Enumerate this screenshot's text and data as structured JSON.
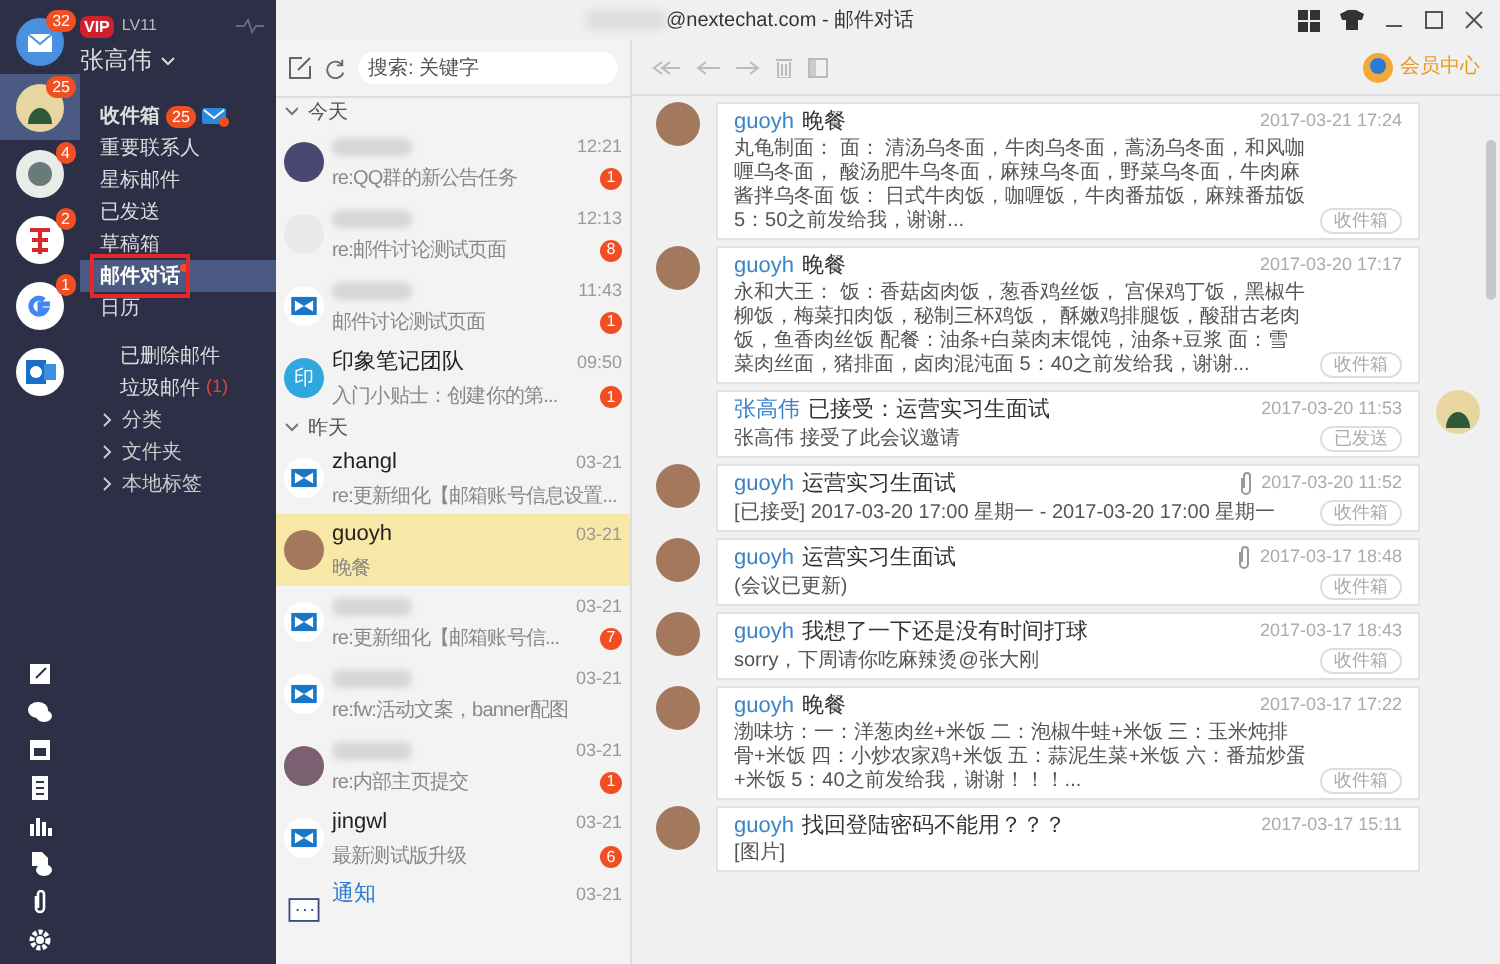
{
  "window": {
    "title": "@nextechat.com - 邮件对话"
  },
  "accounts": [
    {
      "kind": "mail",
      "badge": "32",
      "selected": false
    },
    {
      "kind": "avatar",
      "badge": "25",
      "selected": true
    },
    {
      "kind": "photo",
      "badge": "4",
      "selected": false
    },
    {
      "kind": "netease",
      "badge": "2",
      "selected": false
    },
    {
      "kind": "google",
      "badge": "1",
      "selected": false
    },
    {
      "kind": "outlook",
      "selected": false
    }
  ],
  "user": {
    "vip": "VIP",
    "level": "LV11",
    "name": "张高伟"
  },
  "folders": [
    {
      "kind": "item",
      "label": "收件箱",
      "badge": "25",
      "selected": false
    },
    {
      "kind": "item",
      "label": "重要联系人",
      "selected": false
    },
    {
      "kind": "item",
      "label": "星标邮件",
      "selected": false
    },
    {
      "kind": "item",
      "label": "已发送",
      "selected": false
    },
    {
      "kind": "item",
      "label": "草稿箱",
      "selected": false
    },
    {
      "kind": "item",
      "label": "邮件对话",
      "selected": true,
      "dot": true,
      "highlight_box": true
    },
    {
      "kind": "item",
      "label": "日历",
      "selected": false
    },
    {
      "kind": "subitem",
      "label": "已删除邮件",
      "selected": false
    },
    {
      "kind": "subitem",
      "label": "垃圾邮件",
      "count": "(1)",
      "selected": false
    },
    {
      "kind": "group",
      "label": "分类",
      "expanded": false
    },
    {
      "kind": "group",
      "label": "文件夹",
      "expanded": false
    },
    {
      "kind": "group",
      "label": "本地标签",
      "expanded": false
    }
  ],
  "tools": [
    {
      "kind": "note"
    },
    {
      "kind": "chat"
    },
    {
      "kind": "calendar"
    },
    {
      "kind": "contacts"
    },
    {
      "kind": "stats"
    },
    {
      "kind": "cloud"
    },
    {
      "kind": "attachment"
    },
    {
      "kind": "settings"
    }
  ],
  "search": {
    "placeholder": "搜索: 关键字"
  },
  "conversation_groups": [
    {
      "label": "今天",
      "expanded": true,
      "items": [
        {
          "kind": "photo",
          "time": "12:21",
          "preview": "re:QQ群的新公告任务",
          "badge": "1",
          "selected": false
        },
        {
          "kind": "photo2",
          "time": "12:13",
          "preview": "re:邮件讨论测试页面",
          "badge": "8",
          "selected": false
        },
        {
          "kind": "app",
          "time": "11:43",
          "preview": "邮件讨论测试页面",
          "badge": "1",
          "selected": false
        },
        {
          "kind": "initials",
          "initials": "印",
          "name": "印象笔记团队",
          "time": "09:50",
          "preview": "入门小贴士：创建你的第...",
          "badge": "1",
          "selected": false
        }
      ]
    },
    {
      "label": "昨天",
      "expanded": true,
      "items": [
        {
          "kind": "app",
          "name": "zhangl",
          "time": "03-21",
          "preview": "re:更新细化【邮箱账号信息设置...",
          "selected": false
        },
        {
          "kind": "photo3",
          "name": "guoyh",
          "time": "03-21",
          "preview": "晚餐",
          "selected": true
        },
        {
          "kind": "app",
          "time": "03-21",
          "preview": "re:更新细化【邮箱账号信...",
          "badge": "7",
          "selected": false
        },
        {
          "kind": "app",
          "time": "03-21",
          "preview": "re:fw:活动文案，banner配图",
          "selected": false
        },
        {
          "kind": "photo4",
          "time": "03-21",
          "preview": "re:内部主页提交",
          "badge": "1",
          "selected": false
        },
        {
          "kind": "app",
          "name": "jingwl",
          "time": "03-21",
          "preview": "最新测试版升级",
          "badge": "6",
          "selected": false
        },
        {
          "kind": "notice",
          "name": "通知",
          "time": "03-21",
          "selected": false
        }
      ]
    }
  ],
  "member_center": "会员中心",
  "messages": [
    {
      "outgoing": false,
      "sender": "guoyh",
      "subject": "晚餐",
      "time": "2017-03-21 17:24",
      "attachment": false,
      "body": "丸龟制面： 面： 清汤乌冬面，牛肉乌冬面，蒿汤乌冬面，和风咖喱乌冬面， 酸汤肥牛乌冬面，麻辣乌冬面，野菜乌冬面，牛肉麻酱拌乌冬面 饭： 日式牛肉饭，咖喱饭，牛肉番茄饭，麻辣番茄饭 5：50之前发给我，谢谢...",
      "folder": "收件箱"
    },
    {
      "outgoing": false,
      "sender": "guoyh",
      "subject": "晚餐",
      "time": "2017-03-20 17:17",
      "attachment": false,
      "body": "永和大王： 饭：香菇卤肉饭，葱香鸡丝饭， 宫保鸡丁饭，黑椒牛柳饭，梅菜扣肉饭，秘制三杯鸡饭， 酥嫩鸡排腿饭，酸甜古老肉饭，鱼香肉丝饭 配餐：油条+白菜肉末馄饨，油条+豆浆 面：雪菜肉丝面，猪排面，卤肉混沌面 5：40之前发给我，谢谢...",
      "folder": "收件箱"
    },
    {
      "outgoing": true,
      "sender": "张高伟",
      "subject": "已接受：运营实习生面试",
      "time": "2017-03-20 11:53",
      "attachment": false,
      "body": "张高伟 接受了此会议邀请",
      "folder": "已发送"
    },
    {
      "outgoing": false,
      "sender": "guoyh",
      "subject": "运营实习生面试",
      "time": "2017-03-20 11:52",
      "attachment": true,
      "body": "[已接受] 2017-03-20 17:00 星期一 - 2017-03-20 17:00 星期一",
      "folder": "收件箱"
    },
    {
      "outgoing": false,
      "sender": "guoyh",
      "subject": "运营实习生面试",
      "time": "2017-03-17 18:48",
      "attachment": true,
      "body": "(会议已更新)",
      "folder": "收件箱"
    },
    {
      "outgoing": false,
      "sender": "guoyh",
      "subject": "我想了一下还是没有时间打球",
      "time": "2017-03-17 18:43",
      "attachment": false,
      "body": "sorry，下周请你吃麻辣烫@张大刚",
      "folder": "收件箱"
    },
    {
      "outgoing": false,
      "sender": "guoyh",
      "subject": "晚餐",
      "time": "2017-03-17 17:22",
      "attachment": false,
      "body": "渤味坊：一：洋葱肉丝+米饭 二：泡椒牛蛙+米饭 三：玉米炖排骨+米饭 四：小炒农家鸡+米饭 五：蒜泥生菜+米饭 六：番茄炒蛋+米饭 5：40之前发给我，谢谢！！！...",
      "folder": "收件箱"
    },
    {
      "outgoing": false,
      "sender": "guoyh",
      "subject": "找回登陆密码不能用？？？",
      "time": "2017-03-17 15:11",
      "attachment": false,
      "body": "[图片]"
    }
  ]
}
